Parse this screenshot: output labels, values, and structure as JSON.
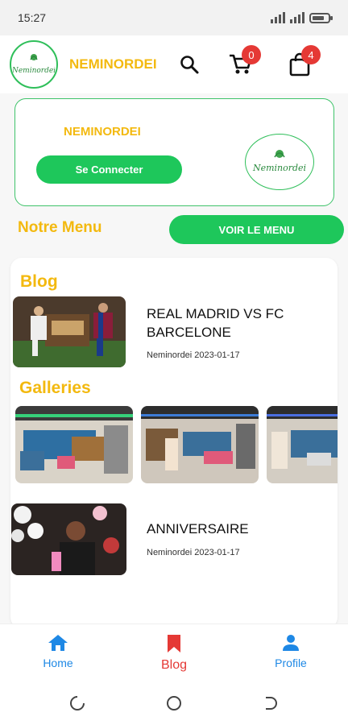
{
  "status": {
    "time": "15:27"
  },
  "header": {
    "brand": "NEMINORDEI",
    "cart_count": "0",
    "bag_count": "4",
    "logo_text": "Neminordei"
  },
  "promo": {
    "title": "NEMINORDEI",
    "connect_label": "Se Connecter",
    "logo_text": "Neminordei"
  },
  "menu": {
    "title": "Notre Menu",
    "button_label": "VOIR LE MENU"
  },
  "blog": {
    "title": "Blog",
    "post": {
      "title": "REAL MADRID VS FC BARCELONE",
      "meta": "Neminordei 2023-01-17"
    }
  },
  "galleries": {
    "title": "Galleries",
    "post": {
      "title": "ANNIVERSAIRE",
      "meta": "Neminordei 2023-01-17"
    }
  },
  "nav": {
    "home": "Home",
    "blog": "Blog",
    "profile": "Profile"
  },
  "colors": {
    "accent_yellow": "#f3b90f",
    "accent_green": "#1ec75b",
    "badge_red": "#e53935",
    "nav_blue": "#1e88e5",
    "nav_red": "#e53935"
  }
}
